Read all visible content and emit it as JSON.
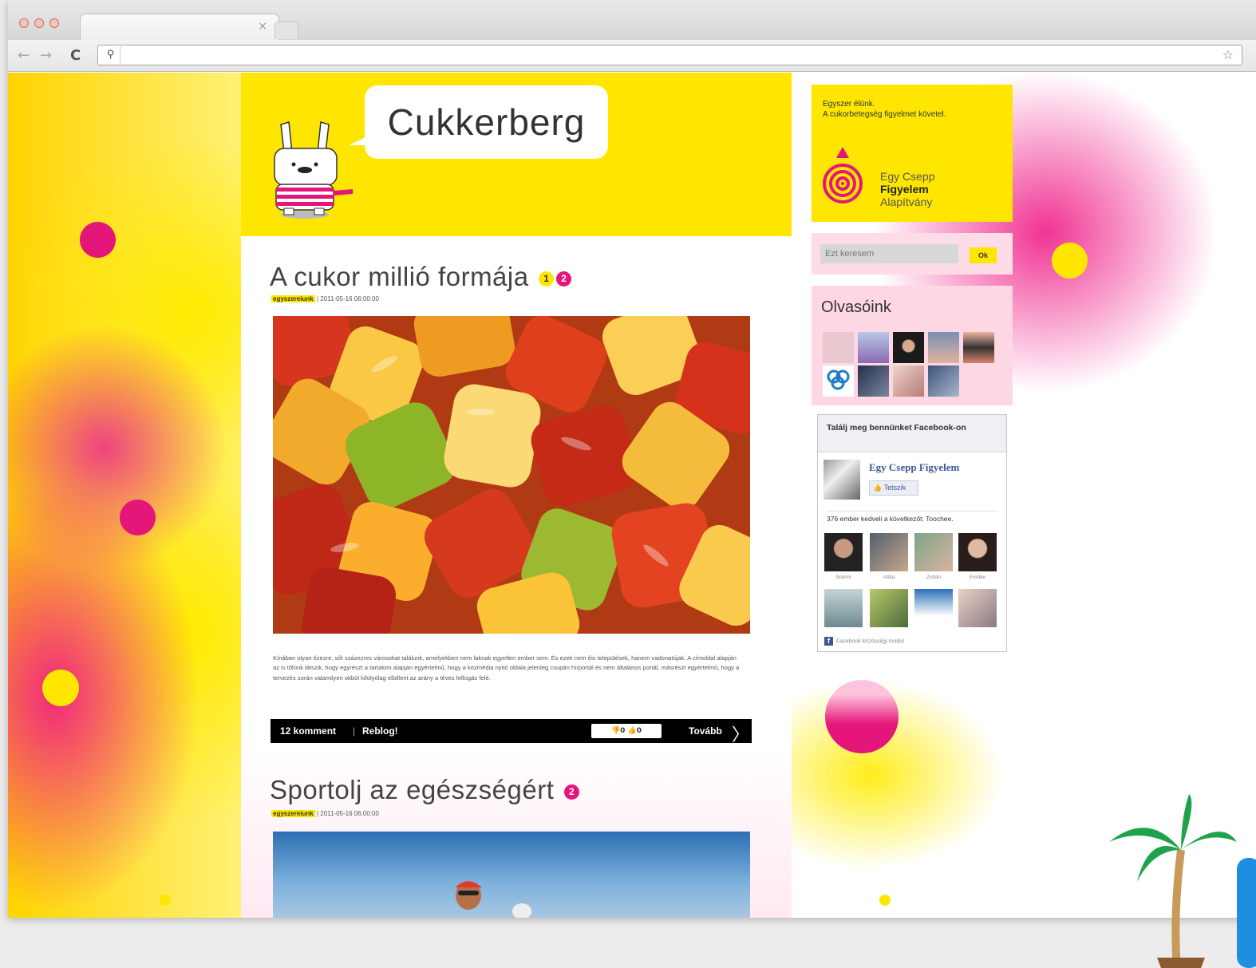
{
  "browser": {
    "tab_close": "×",
    "url": "",
    "search_glyph": "⚲",
    "star": "☆",
    "wrench": "🔧",
    "back": "←",
    "forward": "→",
    "reload": "C"
  },
  "site": {
    "title": "Cukkerberg"
  },
  "posts": [
    {
      "title": "A cukor millió formája",
      "badge1": "1",
      "badge2": "2",
      "author": "egyszereiunk",
      "date": "| 2011-05-16 06:00:00",
      "excerpt": "Kínában olyan tízezre, sőt százezres városokat találunk, amelyekben nem laknak egyetlen ember sem. És ezek nem ősi települések, hanem vadonatújak. A címoldal alapján az is tőlünk látszik, hogy egyrészt a tartalom alapján egyértelmű, hogy a közmédia nyitó oldala jelenleg csupán hírportál és nem általános portál, másrészt egyértelmű, hogy a tervezés során valamilyen okból kifolyólag elbillent az arány a téves felfogás felé.",
      "comments": "12 komment",
      "reblog": "Reblog!",
      "votes": "👎0 👍0",
      "more": "Tovább"
    },
    {
      "title": "Sportolj az egészségért",
      "badge2": "2",
      "author": "egyszereiunk",
      "date": "| 2011-05-16 06:00:00"
    }
  ],
  "sidebar": {
    "promo_line1": "Egyszer élünk.",
    "promo_line2": "A cukorbetegség figyelmet követel.",
    "foundation_l1": "Egy Csepp",
    "foundation_l2": "Figyelem",
    "foundation_l3": "Alapítvány",
    "search_placeholder": "Ezt keresem",
    "search_button": "Ok",
    "readers_title": "Olvasóink",
    "fb_heading": "Találj meg bennünket Facebook-on",
    "fb_page": "Egy Csepp Figyelem",
    "fb_like": "Tetszik",
    "fb_count": "376 ember kedveli a következőt: Toochee.",
    "fb_names": [
      "Noémi",
      "Attila",
      "Zoltán",
      "Emőke"
    ],
    "fb_footer": "Facebook közösségi modul"
  },
  "colors": {
    "yellow": "#ffe600",
    "pink": "#e5167a",
    "fb_blue": "#3b5998"
  },
  "icons": [
    "search-icon",
    "star-icon",
    "wrench-icon",
    "back-icon",
    "forward-icon",
    "reload-icon",
    "close-icon",
    "facebook-icon",
    "thumbs-up-icon",
    "chevron-right-icon"
  ]
}
